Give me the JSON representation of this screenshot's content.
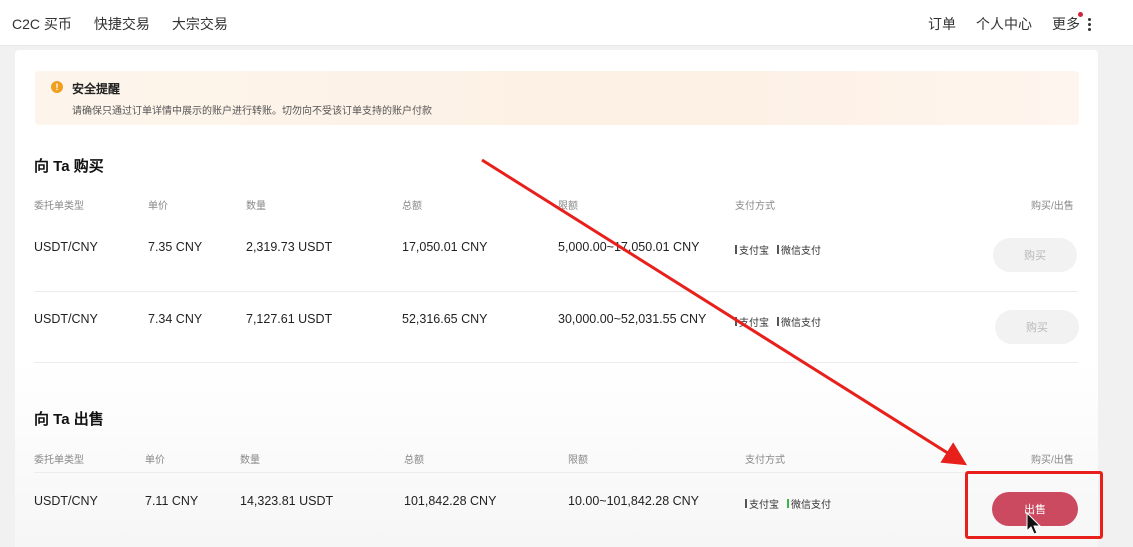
{
  "nav": {
    "left": [
      "C2C 买币",
      "快捷交易",
      "大宗交易"
    ],
    "right": [
      "订单",
      "个人中心"
    ],
    "more": "更多"
  },
  "alert": {
    "icon": "exclamation-icon",
    "title": "安全提醒",
    "text": "请确保只通过订单详情中展示的账户进行转账。切勿向不受该订单支持的账户付款"
  },
  "buy_section": {
    "title": "向 Ta 购买",
    "headers": [
      "委托单类型",
      "单价",
      "数量",
      "总额",
      "限额",
      "支付方式",
      "购买/出售"
    ],
    "rows": [
      {
        "pair": "USDT/CNY",
        "price": "7.35 CNY",
        "amount": "2,319.73 USDT",
        "total": "17,050.01 CNY",
        "limit": "5,000.00~17,050.01 CNY",
        "methods": [
          "支付宝",
          "微信支付"
        ],
        "action": "购买"
      },
      {
        "pair": "USDT/CNY",
        "price": "7.34 CNY",
        "amount": "7,127.61 USDT",
        "total": "52,316.65 CNY",
        "limit": "30,000.00~52,031.55 CNY",
        "methods": [
          "支付宝",
          "微信支付"
        ],
        "action": "购买"
      }
    ]
  },
  "sell_section": {
    "title": "向 Ta 出售",
    "headers": [
      "委托单类型",
      "单价",
      "数量",
      "总额",
      "限额",
      "支付方式",
      "购买/出售"
    ],
    "rows": [
      {
        "pair": "USDT/CNY",
        "price": "7.11 CNY",
        "amount": "14,323.81 USDT",
        "total": "101,842.28 CNY",
        "limit": "10.00~101,842.28 CNY",
        "methods": [
          "支付宝",
          "微信支付"
        ],
        "action": "出售"
      }
    ]
  },
  "colors": {
    "sell_button": "#cc4a60",
    "annotation_red": "#e8201c",
    "alert_bg": "#fdf3e9",
    "alert_icon": "#f0a020"
  }
}
